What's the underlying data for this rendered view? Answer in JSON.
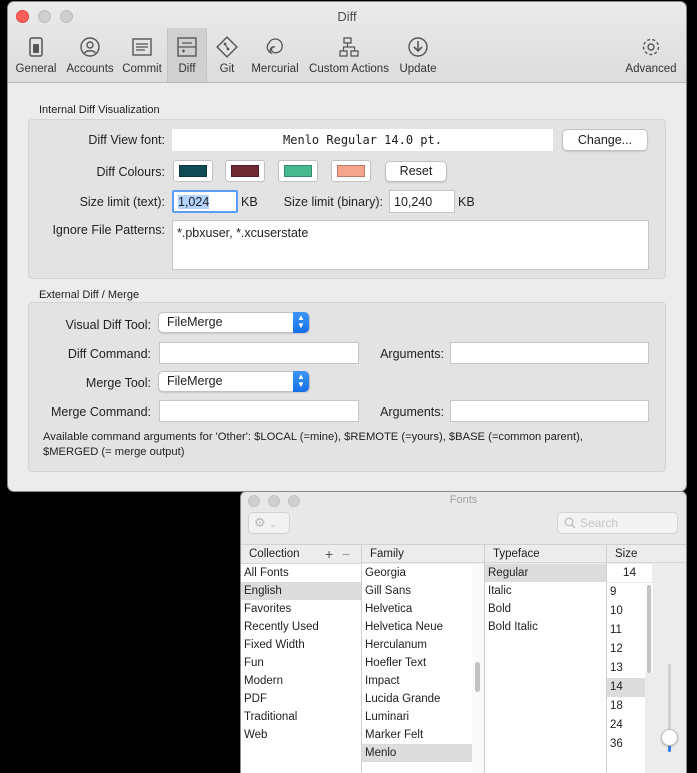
{
  "window": {
    "title": "Diff",
    "toolbar": [
      {
        "label": "General",
        "icon": "general-icon"
      },
      {
        "label": "Accounts",
        "icon": "accounts-icon"
      },
      {
        "label": "Commit",
        "icon": "commit-icon"
      },
      {
        "label": "Diff",
        "icon": "diff-icon",
        "selected": true
      },
      {
        "label": "Git",
        "icon": "git-icon"
      },
      {
        "label": "Mercurial",
        "icon": "mercurial-icon"
      },
      {
        "label": "Custom Actions",
        "icon": "custom-actions-icon"
      },
      {
        "label": "Update",
        "icon": "update-icon"
      },
      {
        "label": "Advanced",
        "icon": "advanced-icon"
      }
    ]
  },
  "internal": {
    "section_label": "Internal Diff Visualization",
    "font_label": "Diff View font:",
    "font_value": "Menlo Regular 14.0 pt.",
    "change_button": "Change...",
    "colours_label": "Diff Colours:",
    "colours": [
      "#0f4b55",
      "#6e2b33",
      "#46b98f",
      "#f4a58c"
    ],
    "reset_button": "Reset",
    "size_text_label": "Size limit (text):",
    "size_text_value": "1,024",
    "size_text_unit": "KB",
    "size_binary_label": "Size limit (binary):",
    "size_binary_value": "10,240",
    "size_binary_unit": "KB",
    "ignore_label": "Ignore File Patterns:",
    "ignore_value": "*.pbxuser, *.xcuserstate"
  },
  "external": {
    "section_label": "External Diff / Merge",
    "visual_tool_label": "Visual Diff Tool:",
    "visual_tool_value": "FileMerge",
    "diff_command_label": "Diff Command:",
    "diff_command_value": "",
    "diff_args_label": "Arguments:",
    "diff_args_value": "",
    "merge_tool_label": "Merge Tool:",
    "merge_tool_value": "FileMerge",
    "merge_command_label": "Merge Command:",
    "merge_command_value": "",
    "merge_args_label": "Arguments:",
    "merge_args_value": "",
    "note_line1": "Available command arguments for 'Other': $LOCAL (=mine), $REMOTE (=yours), $BASE (=common parent),",
    "note_line2": "$MERGED (= merge output)"
  },
  "fonts_panel": {
    "title": "Fonts",
    "search_placeholder": "Search",
    "headers": {
      "collection": "Collection",
      "family": "Family",
      "typeface": "Typeface",
      "size": "Size"
    },
    "collections": [
      "All Fonts",
      "English",
      "Favorites",
      "Recently Used",
      "Fixed Width",
      "Fun",
      "Modern",
      "PDF",
      "Traditional",
      "Web"
    ],
    "collections_selected": "English",
    "families": [
      "Georgia",
      "Gill Sans",
      "Helvetica",
      "Helvetica Neue",
      "Herculanum",
      "Hoefler Text",
      "Impact",
      "Lucida Grande",
      "Luminari",
      "Marker Felt",
      "Menlo"
    ],
    "families_selected": "Menlo",
    "typefaces": [
      "Regular",
      "Italic",
      "Bold",
      "Bold Italic"
    ],
    "typefaces_selected": "Regular",
    "size_value": "14",
    "sizes": [
      "9",
      "10",
      "11",
      "12",
      "13",
      "14",
      "18",
      "24",
      "36"
    ],
    "sizes_selected": "14",
    "size_slider_level": 0.15
  }
}
